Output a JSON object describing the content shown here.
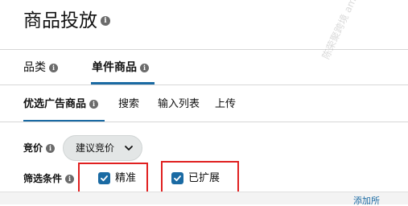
{
  "page": {
    "title": "商品投放",
    "info_icon": "info-icon"
  },
  "tabs_level1": [
    {
      "label": "品类",
      "active": false
    },
    {
      "label": "单件商品",
      "active": true
    }
  ],
  "tabs_level2": [
    {
      "label": "优选广告商品",
      "active": true
    },
    {
      "label": "搜索",
      "active": false
    },
    {
      "label": "输入列表",
      "active": false
    },
    {
      "label": "上传",
      "active": false
    }
  ],
  "bid": {
    "label": "竞价",
    "dropdown_value": "建议竞价",
    "dropdown_icon": "chevron-down-icon"
  },
  "filter": {
    "label": "筛选条件",
    "options": [
      {
        "label": "精准",
        "checked": true
      },
      {
        "label": "已扩展",
        "checked": true
      }
    ]
  },
  "bottom": {
    "link_text": "添加所"
  },
  "watermark": "陈荣聚跨境 amzchen.com",
  "colors": {
    "accent": "#1a6aa3",
    "highlight_box": "#e02020",
    "dropdown_bg": "#e3e6e6"
  }
}
